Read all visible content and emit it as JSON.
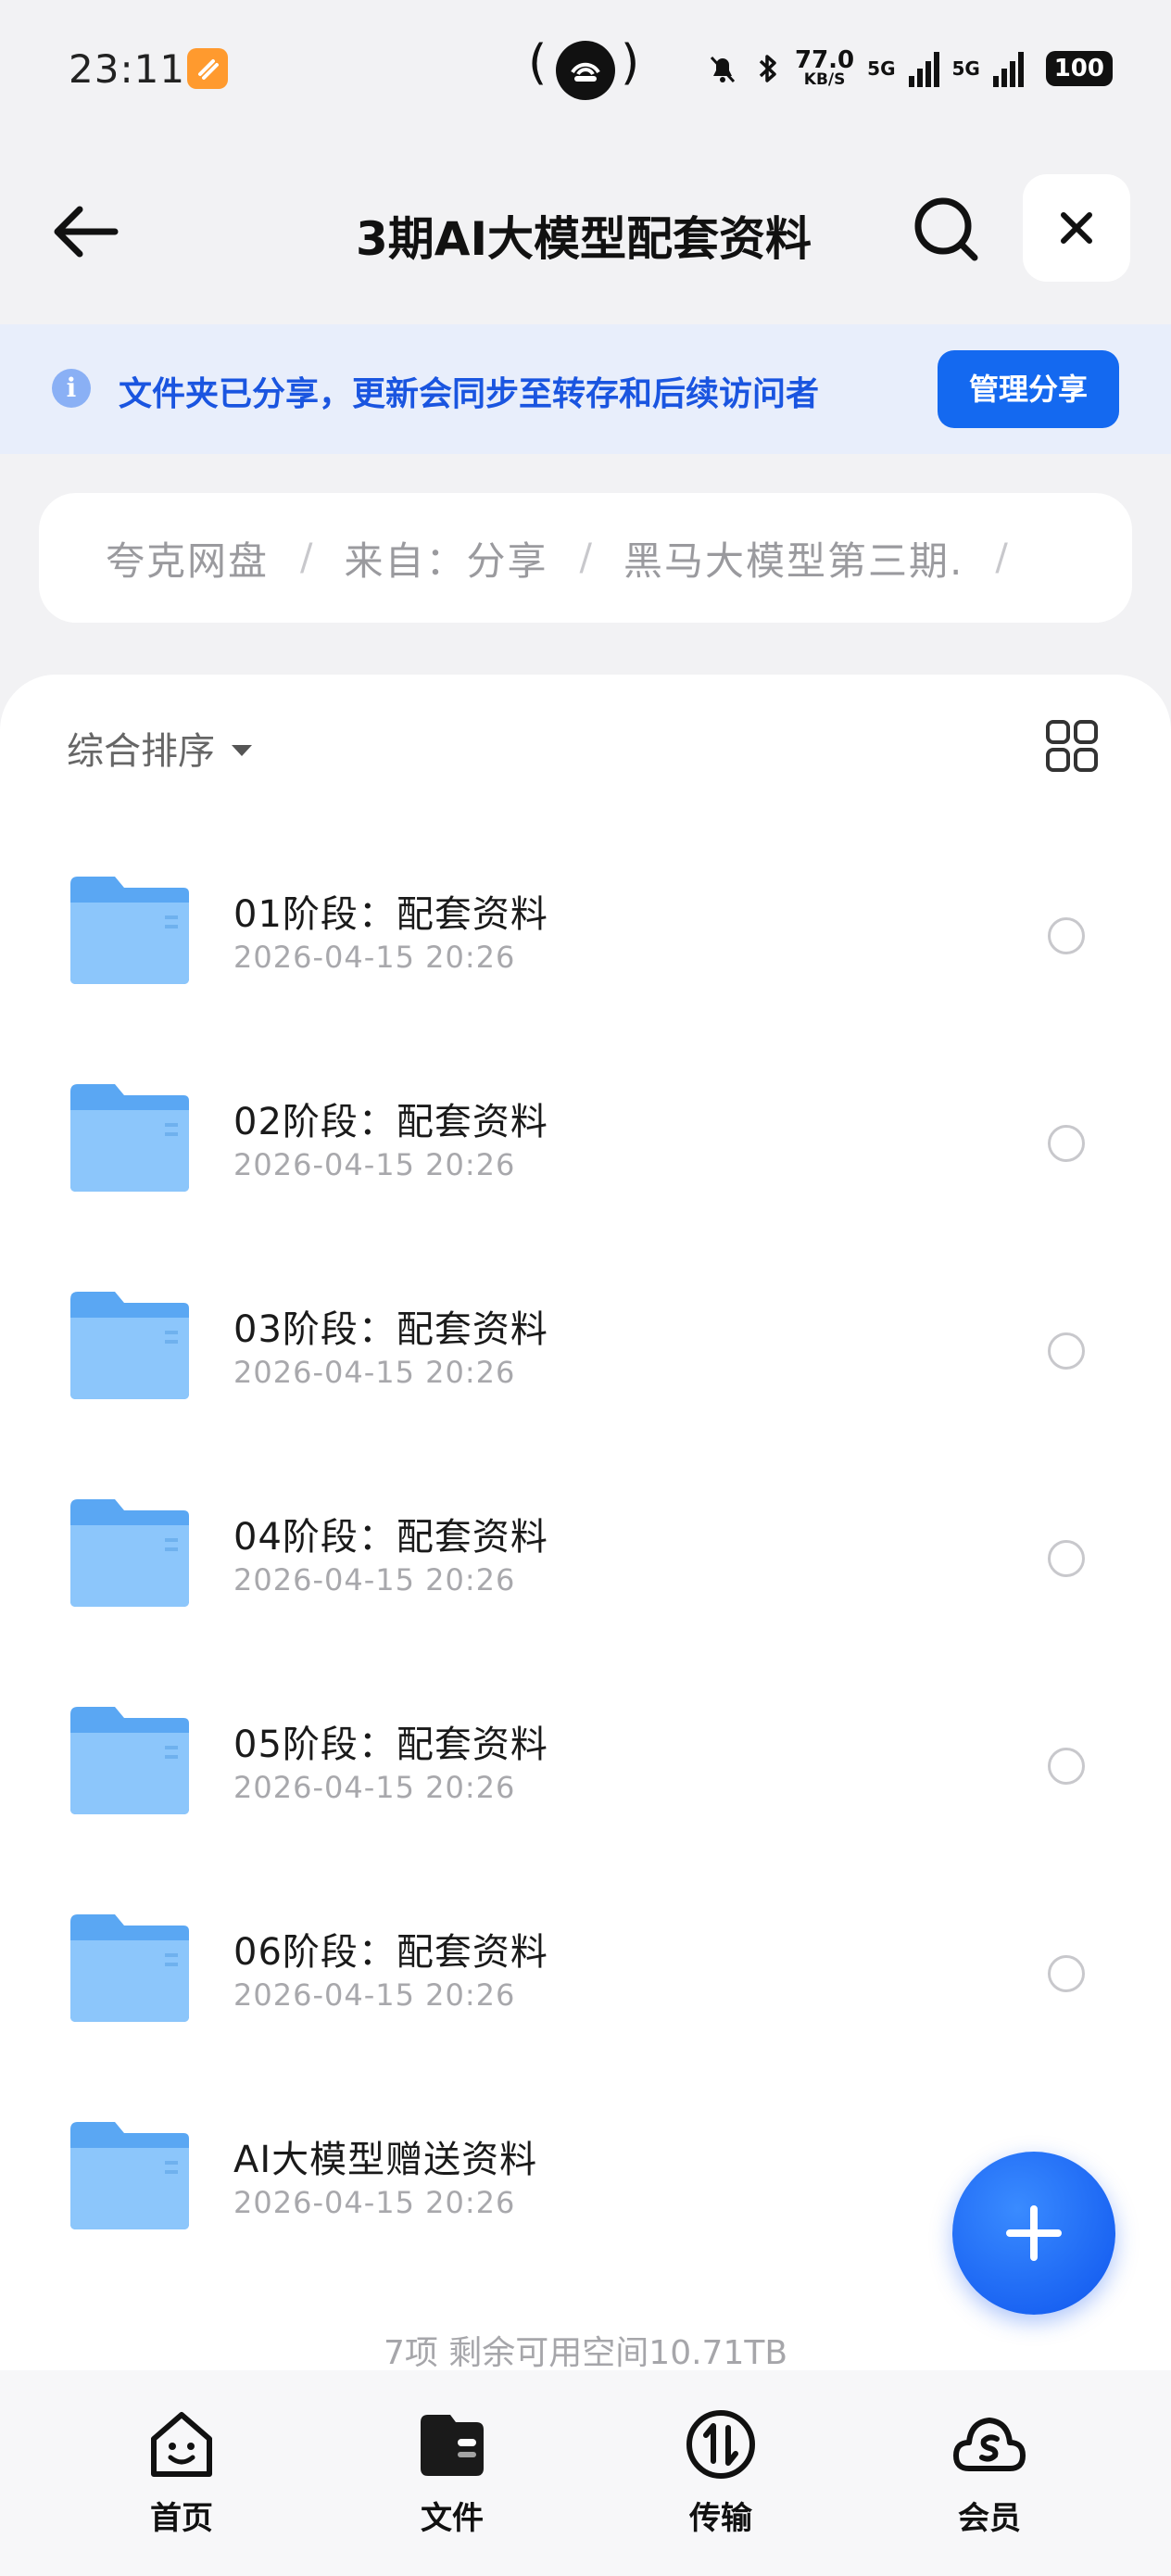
{
  "status_bar": {
    "time": "23:11",
    "speed_value": "77.0",
    "speed_unit": "KB/S",
    "network_1": "5G",
    "network_2": "5G",
    "battery": "100"
  },
  "header": {
    "title": "3期AI大模型配套资料",
    "back_icon": "arrow-left-icon",
    "search_icon": "search-icon",
    "close_icon": "close-icon"
  },
  "banner": {
    "icon": "info-icon",
    "text": "文件夹已分享，更新会同步至转存和后续访问者",
    "button_label": "管理分享",
    "accent": "#1469f0"
  },
  "breadcrumb": {
    "items": [
      "夸克网盘",
      "来自：分享",
      "黑马大模型第三期."
    ],
    "separator": "/"
  },
  "list": {
    "sort_label": "综合排序",
    "view_toggle_icon": "grid-view-icon",
    "items": [
      {
        "name": "01阶段：配套资料",
        "date": "2026-04-15 20:26"
      },
      {
        "name": "02阶段：配套资料",
        "date": "2026-04-15 20:26"
      },
      {
        "name": "03阶段：配套资料",
        "date": "2026-04-15 20:26"
      },
      {
        "name": "04阶段：配套资料",
        "date": "2026-04-15 20:26"
      },
      {
        "name": "05阶段：配套资料",
        "date": "2026-04-15 20:26"
      },
      {
        "name": "06阶段：配套资料",
        "date": "2026-04-15 20:26"
      },
      {
        "name": "AI大模型赠送资料",
        "date": "2026-04-15 20:26"
      }
    ],
    "footer": "7项 剩余可用空间10.71TB"
  },
  "fab": {
    "icon": "plus-icon"
  },
  "bottom_nav": {
    "items": [
      {
        "label": "首页",
        "icon": "home-face-icon"
      },
      {
        "label": "文件",
        "icon": "folder-wallet-icon"
      },
      {
        "label": "传输",
        "icon": "transfer-icon"
      },
      {
        "label": "会员",
        "icon": "member-cloud-icon"
      }
    ]
  }
}
